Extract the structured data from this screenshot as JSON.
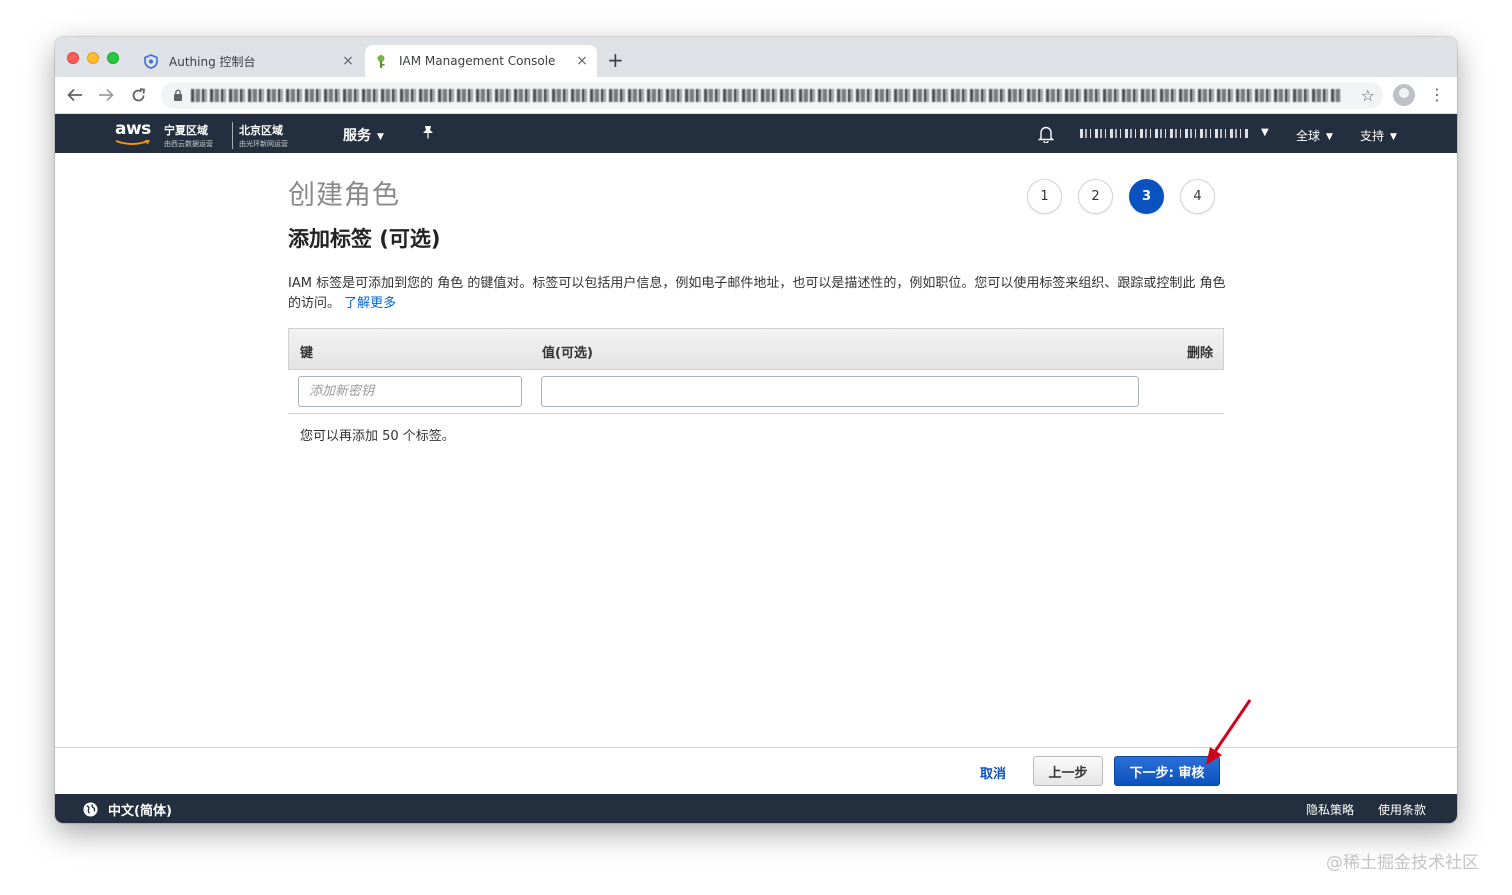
{
  "browser": {
    "tabs": [
      {
        "title": "Authing 控制台",
        "active": false,
        "icon": "authing-shield-icon"
      },
      {
        "title": "IAM Management Console",
        "active": true,
        "icon": "iam-key-icon"
      }
    ],
    "new_tab_label": "+",
    "close_label": "×"
  },
  "aws_nav": {
    "logo": "aws",
    "region_ningxia": {
      "name": "宁夏区域",
      "operator": "由西云数据运营"
    },
    "region_beijing": {
      "name": "北京区域",
      "operator": "由光环新网运营"
    },
    "services": "服务",
    "global": "全球",
    "support": "支持"
  },
  "page": {
    "title": "创建角色",
    "steps": [
      "1",
      "2",
      "3",
      "4"
    ],
    "current_step": "3",
    "section_title": "添加标签 (可选)",
    "description": "IAM 标签是可添加到您的 角色 的键值对。标签可以包括用户信息，例如电子邮件地址，也可以是描述性的，例如职位。您可以使用标签来组织、跟踪或控制此 角色 的访问。",
    "learn_more": "了解更多",
    "table": {
      "col_key": "键",
      "col_value": "值(可选)",
      "col_delete": "删除",
      "key_placeholder": "添加新密钥",
      "value_placeholder": ""
    },
    "remaining_text": "您可以再添加 50 个标签。"
  },
  "actions": {
    "cancel": "取消",
    "previous": "上一步",
    "next": "下一步: 审核"
  },
  "footer": {
    "language": "中文(简体)",
    "privacy": "隐私策略",
    "terms": "使用条款"
  },
  "watermark": "@稀土掘金技术社区",
  "colors": {
    "aws_nav_bg": "#232f3e",
    "primary_blue": "#0a52bf",
    "link_blue": "#0066cc",
    "annotation_red": "#d0021b"
  }
}
